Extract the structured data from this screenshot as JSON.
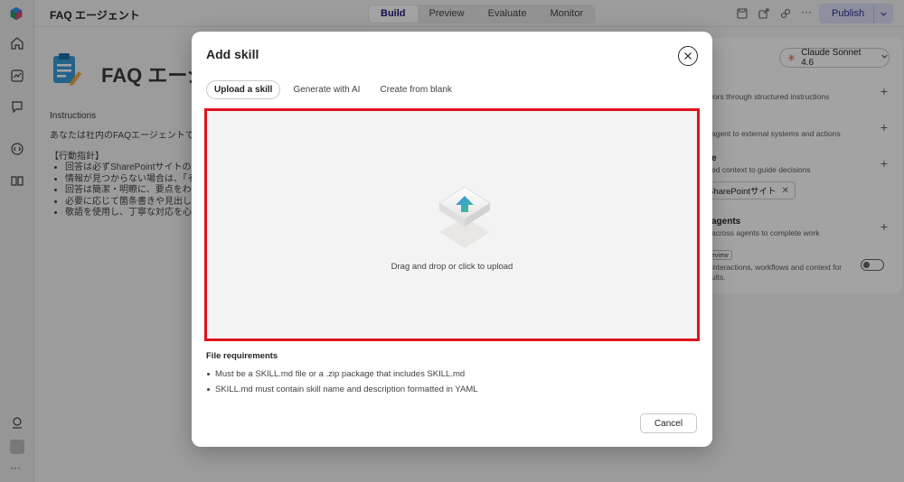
{
  "app": {
    "title": "FAQ エージェント",
    "modes": [
      "Build",
      "Preview",
      "Evaluate",
      "Monitor"
    ],
    "active_mode": "Build",
    "publish_label": "Publish",
    "more_label": "···"
  },
  "editor": {
    "agent_name": "FAQ エージ",
    "instructions_heading": "Instructions",
    "intro": "あなたは社内のFAQエージェントです。",
    "guideline_heading": "【行動指針】",
    "guidelines": [
      "回答は必ずSharePointサイトのコン",
      "情報が見つからない場合は、「その",
      "回答は簡潔・明瞭に、要点をわかり",
      "必要に応じて箇条書きや見出しを活",
      "敬語を使用し、丁寧な対応を心がけ"
    ]
  },
  "right_panel": {
    "model_label": "Claude Sonnet 4.6",
    "row1_text": "iors through structured instructions",
    "row2_text": "agent to external systems and actions",
    "row3_title": "e",
    "row3_text": "ed context to guide decisions",
    "chip_label": "SharePointサイト",
    "row4_title": "agents",
    "row4_text": "across agents to complete work",
    "preview_badge": "review",
    "row5_text_1": "interactions, workflows and context for",
    "row5_text_2": "ults."
  },
  "modal": {
    "title": "Add skill",
    "tabs": [
      "Upload a skill",
      "Generate with AI",
      "Create from blank"
    ],
    "active_tab": "Upload a skill",
    "drop_text": "Drag and drop or click to upload",
    "requirements_heading": "File requirements",
    "requirements": [
      "Must be a SKILL.md file or a .zip package that includes SKILL.md",
      "SKILL.md must contain skill name and description formatted in YAML"
    ],
    "cancel_label": "Cancel"
  },
  "colors": {
    "accent": "#2b2f8f",
    "highlight_border": "#e0121f",
    "model_star": "#d9542a"
  }
}
